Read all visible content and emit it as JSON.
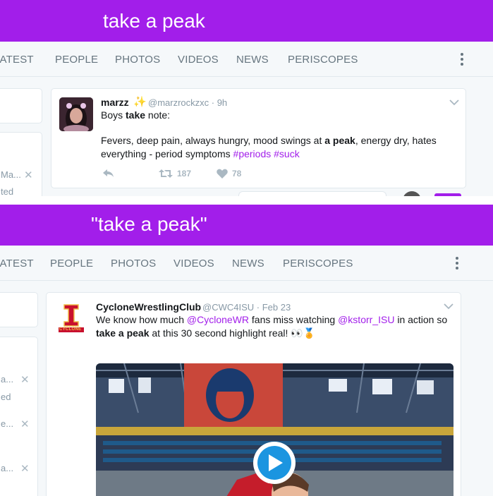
{
  "colors": {
    "accent": "#a21eea",
    "link": "#a21eea",
    "muted": "#66757f"
  },
  "top": {
    "search_query": "take a peak",
    "tabs": [
      "LATEST",
      "PEOPLE",
      "PHOTOS",
      "VIDEOS",
      "NEWS",
      "PERISCOPES"
    ],
    "sidebar": {
      "item1": "Ma...",
      "item2": "ted"
    },
    "tweet": {
      "name": "marzz",
      "name_icon": "sparkles-icon",
      "handle": "@marzrockzxc · 9h",
      "line1_pre": "Boys ",
      "line1_bold": "take",
      "line1_post": " note:",
      "line2_pre": "Fevers, deep pain, always hungry, mood swings at ",
      "line2_bold": "a peak",
      "line2_post": ", energy dry, hates",
      "line3_pre": "everything - period symptoms ",
      "hashtag1": "#periods",
      "hashtag2": "#suck",
      "retweets": "187",
      "likes": "78"
    }
  },
  "bottom": {
    "search_query": "\"take a peak\"",
    "tabs": [
      "LATEST",
      "PEOPLE",
      "PHOTOS",
      "VIDEOS",
      "NEWS",
      "PERISCOPES"
    ],
    "sidebar": {
      "item1": "a...",
      "item2": "ed",
      "item3": "e...",
      "item4": "a..."
    },
    "tweet": {
      "name": "CycloneWrestlingClub",
      "handle": "@CWC4ISU · Feb 23",
      "line1_pre": "We know how much ",
      "mention1": "@CycloneWR",
      "line1_mid": " fans miss watching ",
      "mention2": "@kstorr_ISU",
      "line1_post": " in action so",
      "line2_bold": "take a peak",
      "line2_post": " at this 30 second highlight real! 👀🏅",
      "avatar_text": "CYCLONE"
    }
  }
}
